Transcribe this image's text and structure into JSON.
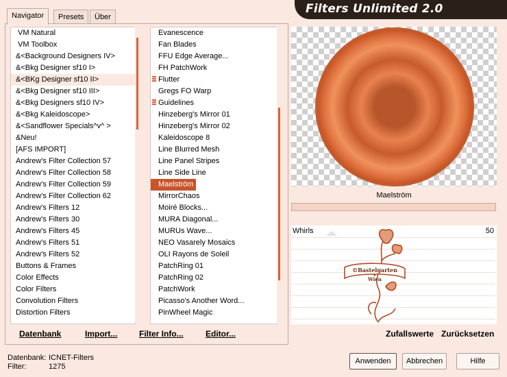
{
  "app": {
    "title": "Filters Unlimited 2.0"
  },
  "tabs": [
    {
      "label": "Navigator"
    },
    {
      "label": "Presets"
    },
    {
      "label": "Über"
    }
  ],
  "categories": [
    "VM Natural",
    "VM Toolbox",
    "&<Background Designers IV>",
    "&<Bkg Designer sf10 I>",
    "&<BKg Designer sf10 II>",
    "&<Bkg Designer sf10 III>",
    "&<Bkg Designers sf10 IV>",
    "&<Bkg Kaleidoscope>",
    "&<Sandflower Specials^v^ >",
    "&Neu!",
    "[AFS IMPORT]",
    "Andrew's Filter Collection 57",
    "Andrew's Filter Collection 58",
    "Andrew's Filter Collection 59",
    "Andrew's Filter Collection 62",
    "Andrew's Filters 12",
    "Andrew's Filters 30",
    "Andrew's Filters 45",
    "Andrew's Filters 51",
    "Andrew's Filters 52",
    "Buttons & Frames",
    "Color Effects",
    "Color Filters",
    "Convolution Filters",
    "Distortion Filters"
  ],
  "filters": [
    "Evanescence",
    "Fan Blades",
    "FFU Edge Average...",
    "FH PatchWork",
    "Flutter",
    "Gregs FO Warp",
    "Guidelines",
    "Hinzeberg's Mirror 01",
    "Hinzeberg's Mirror 02",
    "Kaleidoscope 8",
    "Line Blurred Mesh",
    "Line Panel Stripes",
    "Line Side Line",
    "Maelström",
    "MirrorChaos",
    "Moiré Blocks...",
    "MURA Diagonal...",
    "MURUs Wave...",
    "NEO Vasarely Mosaics",
    "OLI Rayons de Soleil",
    "PatchRing 01",
    "PatchRing 02",
    "PatchWork",
    "Picasso's Another Word...",
    "PinWheel Magic"
  ],
  "preview": {
    "filter_name": "Maelström"
  },
  "param": {
    "name": "Whirls",
    "value": "50"
  },
  "watermark": {
    "line1": "©Bastelgarten",
    "line2": "Wien"
  },
  "links": {
    "datenbank": "Datenbank",
    "import": "Import...",
    "filter_info": "Filter Info...",
    "editor": "Editor...",
    "zufallswerte": "Zufallswerte",
    "zuruecksetzen": "Zurücksetzen"
  },
  "status": {
    "db_label": "Datenbank:",
    "db_value": "ICNET-Filters",
    "filter_label": "Filter:",
    "filter_value": "1275"
  },
  "buttons": {
    "apply": "Anwenden",
    "cancel": "Abbrechen",
    "help": "Hilfe"
  }
}
